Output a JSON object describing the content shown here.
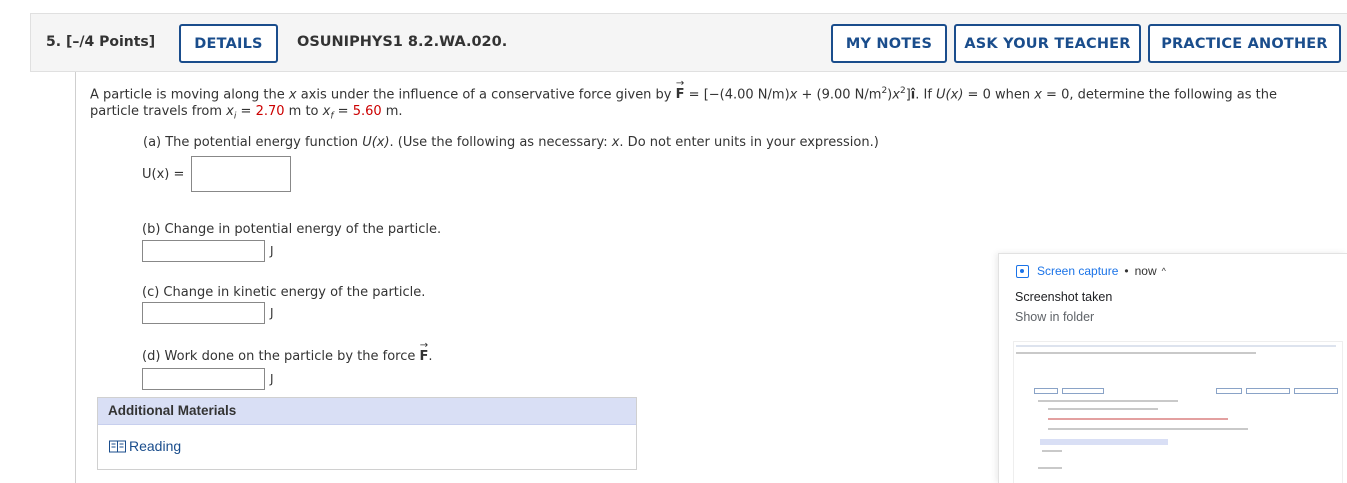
{
  "header": {
    "question_number": "5.",
    "points": "[–/4 Points]",
    "details_label": "DETAILS",
    "question_code": "OSUNIPHYS1 8.2.WA.020.",
    "my_notes_label": "MY NOTES",
    "ask_teacher_label": "ASK YOUR TEACHER",
    "practice_another_label": "PRACTICE ANOTHER"
  },
  "problem": {
    "intro_1": "A particle is moving along the ",
    "x_var": "x",
    "intro_2": " axis under the influence of a conservative force given by ",
    "force_symbol": "F",
    "intro_3": " = [−(4.00 N/m)",
    "intro_4": " + (9.00 N/m",
    "sq": "2",
    "intro_5": ")",
    "intro_6": "]",
    "ihat": "î",
    "intro_7": ". If ",
    "U_of_x": "U(x)",
    "intro_8": " = 0 when ",
    "intro_9": " = 0, determine the following as the",
    "line2_a": "particle travels from ",
    "xi_sub": "i",
    "eq": " = ",
    "xi_value": "2.70",
    "line2_b": " m to ",
    "xf_sub": "f",
    "xf_value": "5.60",
    "line2_c": " m."
  },
  "parts": {
    "a_label_1": "(a) The potential energy function ",
    "a_label_2": ". (Use the following as necessary: ",
    "a_label_3": ". Do not enter units in your expression.)",
    "a_input_label": "U(x) =",
    "a_input_value": "",
    "b_label": "(b) Change in potential energy of the particle.",
    "b_input_value": "",
    "b_unit": "J",
    "c_label": "(c) Change in kinetic energy of the particle.",
    "c_input_value": "",
    "c_unit": "J",
    "d_label": "(d) Work done on the particle by the force ",
    "d_force": "F",
    "d_period": ".",
    "d_input_value": "",
    "d_unit": "J"
  },
  "additional_materials": {
    "title": "Additional Materials",
    "reading_label": "Reading"
  },
  "notification": {
    "app_name": "Screen capture",
    "dot": "•",
    "when": "now",
    "chevron": "^",
    "title": "Screenshot taken",
    "subtitle": "Show in folder"
  },
  "colors": {
    "accent_blue": "#1a4d8c",
    "given_value_red": "#cc0000",
    "additional_materials_header": "#d9dff5"
  }
}
